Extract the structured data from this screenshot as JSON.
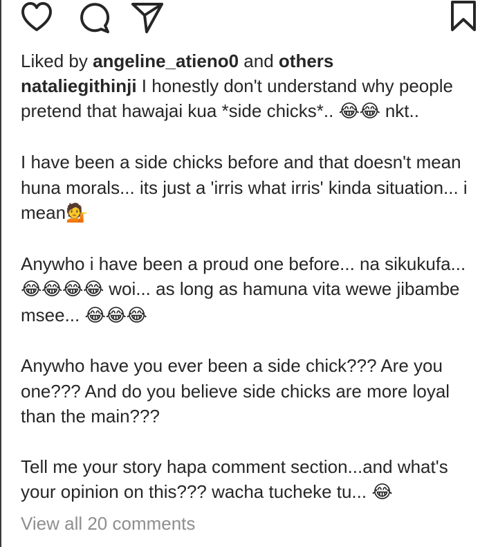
{
  "actions": {
    "icons": [
      "heart-icon",
      "comment-icon",
      "share-icon",
      "bookmark-icon"
    ]
  },
  "likes": {
    "prefix": "Liked by",
    "user": "angeline_atieno0",
    "middle": "and",
    "others": "others"
  },
  "caption": {
    "username": "nataliegithinji",
    "paragraphs": [
      {
        "text": " I honestly don't understand why people pretend that hawajai kua *side chicks*.. ",
        "emoji": "😂😂",
        "tail": " nkt.."
      },
      {
        "text": "I have been a side chicks before and that doesn't mean huna morals... its just a 'irris what irris' kinda situation... i mean",
        "emoji": "💁",
        "tail": ""
      },
      {
        "text": "Anywho i have been a proud one before... na sikukufa... ",
        "emoji": "😂😂😂😂",
        "tail": " woi... as long as hamuna vita wewe jibambe msee... ",
        "emoji2": "😂😂😂"
      },
      {
        "text": "Anywho have you ever been a side chick??? Are you one??? And do you believe side chicks are more loyal than the main???",
        "emoji": "",
        "tail": ""
      },
      {
        "text": "Tell me your story hapa comment section...and what's your opinion on this??? wacha tucheke tu... ",
        "emoji": "😂",
        "tail": ""
      }
    ]
  },
  "comments": {
    "view_all": "View all 20 comments"
  }
}
